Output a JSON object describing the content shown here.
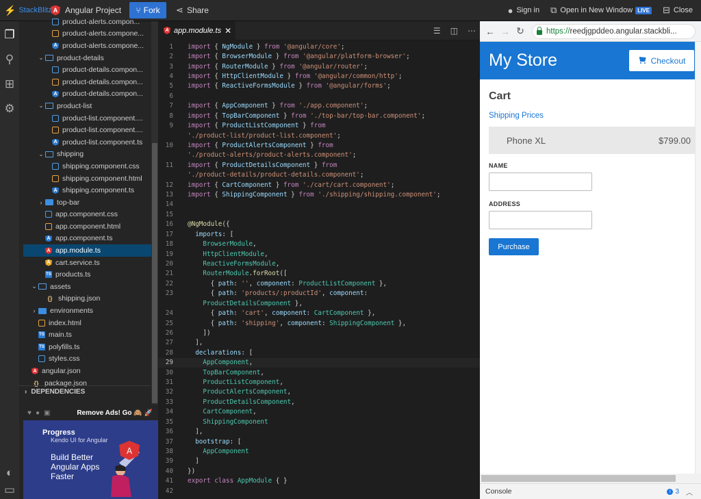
{
  "topbar": {
    "brand": "StackBlitz",
    "project": "Angular Project",
    "fork": "Fork",
    "share": "Share",
    "signin": "Sign in",
    "open_new": "Open in New Window",
    "live": "LIVE",
    "close": "Close"
  },
  "tree": [
    {
      "label": "product-alerts.compon...",
      "type": "css",
      "depth": 3
    },
    {
      "label": "product-alerts.compone...",
      "type": "html",
      "depth": 3
    },
    {
      "label": "product-alerts.compone...",
      "type": "ts",
      "depth": 3
    },
    {
      "label": "product-details",
      "type": "folder",
      "depth": 2,
      "open": true
    },
    {
      "label": "product-details.compon...",
      "type": "css",
      "depth": 3
    },
    {
      "label": "product-details.compon...",
      "type": "html",
      "depth": 3
    },
    {
      "label": "product-details.compon...",
      "type": "ts",
      "depth": 3
    },
    {
      "label": "product-list",
      "type": "folder",
      "depth": 2,
      "open": true
    },
    {
      "label": "product-list.component....",
      "type": "css",
      "depth": 3
    },
    {
      "label": "product-list.component....",
      "type": "html",
      "depth": 3
    },
    {
      "label": "product-list.component.ts",
      "type": "ts",
      "depth": 3
    },
    {
      "label": "shipping",
      "type": "folder",
      "depth": 2,
      "open": true
    },
    {
      "label": "shipping.component.css",
      "type": "css",
      "depth": 3
    },
    {
      "label": "shipping.component.html",
      "type": "html",
      "depth": 3
    },
    {
      "label": "shipping.component.ts",
      "type": "ts",
      "depth": 3
    },
    {
      "label": "top-bar",
      "type": "folder-closed",
      "depth": 2
    },
    {
      "label": "app.component.css",
      "type": "css",
      "depth": 2
    },
    {
      "label": "app.component.html",
      "type": "html",
      "depth": 2
    },
    {
      "label": "app.component.ts",
      "type": "ts",
      "depth": 2
    },
    {
      "label": "app.module.ts",
      "type": "ang",
      "depth": 2,
      "selected": true
    },
    {
      "label": "cart.service.ts",
      "type": "svc",
      "depth": 2
    },
    {
      "label": "products.ts",
      "type": "tsfile",
      "depth": 2
    },
    {
      "label": "assets",
      "type": "folder",
      "depth": 1,
      "open": true
    },
    {
      "label": "shipping.json",
      "type": "json",
      "depth": 2
    },
    {
      "label": "environments",
      "type": "folder-closed",
      "depth": 1
    },
    {
      "label": "index.html",
      "type": "html",
      "depth": 1
    },
    {
      "label": "main.ts",
      "type": "tsfile",
      "depth": 1
    },
    {
      "label": "polyfills.ts",
      "type": "tsfile",
      "depth": 1
    },
    {
      "label": "styles.css",
      "type": "css",
      "depth": 1
    },
    {
      "label": "angular.json",
      "type": "ang",
      "depth": 0
    },
    {
      "label": "package.json",
      "type": "json",
      "depth": 0
    }
  ],
  "dependencies": "DEPENDENCIES",
  "ads": {
    "remove": "Remove Ads! Go 🙈 🚀",
    "brand": "Progress",
    "sub": "Kendo UI for Angular",
    "headline": "Build Better Angular Apps Faster"
  },
  "editor": {
    "tab": "app.module.ts",
    "current_line": 29,
    "lines": [
      {
        "n": "1",
        "t": [
          [
            "k",
            "import"
          ],
          [
            "b",
            " { "
          ],
          [
            "p",
            "NgModule"
          ],
          [
            "b",
            " } "
          ],
          [
            "k",
            "from"
          ],
          [
            "s",
            " '@angular/core'"
          ],
          [
            "b",
            ";"
          ]
        ]
      },
      {
        "n": "2",
        "t": [
          [
            "k",
            "import"
          ],
          [
            "b",
            " { "
          ],
          [
            "p",
            "BrowserModule"
          ],
          [
            "b",
            " } "
          ],
          [
            "k",
            "from"
          ],
          [
            "s",
            " '@angular/platform-browser'"
          ],
          [
            "b",
            ";"
          ]
        ]
      },
      {
        "n": "3",
        "t": [
          [
            "k",
            "import"
          ],
          [
            "b",
            " { "
          ],
          [
            "p",
            "RouterModule"
          ],
          [
            "b",
            " } "
          ],
          [
            "k",
            "from"
          ],
          [
            "s",
            " '@angular/router'"
          ],
          [
            "b",
            ";"
          ]
        ]
      },
      {
        "n": "4",
        "t": [
          [
            "k",
            "import"
          ],
          [
            "b",
            " { "
          ],
          [
            "p",
            "HttpClientModule"
          ],
          [
            "b",
            " } "
          ],
          [
            "k",
            "from"
          ],
          [
            "s",
            " '@angular/common/http'"
          ],
          [
            "b",
            ";"
          ]
        ]
      },
      {
        "n": "5",
        "t": [
          [
            "k",
            "import"
          ],
          [
            "b",
            " { "
          ],
          [
            "p",
            "ReactiveFormsModule"
          ],
          [
            "b",
            " } "
          ],
          [
            "k",
            "from"
          ],
          [
            "s",
            " '@angular/forms'"
          ],
          [
            "b",
            ";"
          ]
        ]
      },
      {
        "n": "6",
        "t": []
      },
      {
        "n": "7",
        "t": [
          [
            "k",
            "import"
          ],
          [
            "b",
            " { "
          ],
          [
            "p",
            "AppComponent"
          ],
          [
            "b",
            " } "
          ],
          [
            "k",
            "from"
          ],
          [
            "s",
            " './app.component'"
          ],
          [
            "b",
            ";"
          ]
        ]
      },
      {
        "n": "8",
        "t": [
          [
            "k",
            "import"
          ],
          [
            "b",
            " { "
          ],
          [
            "p",
            "TopBarComponent"
          ],
          [
            "b",
            " } "
          ],
          [
            "k",
            "from"
          ],
          [
            "s",
            " './top-bar/top-bar.component'"
          ],
          [
            "b",
            ";"
          ]
        ]
      },
      {
        "n": "9",
        "t": [
          [
            "k",
            "import"
          ],
          [
            "b",
            " { "
          ],
          [
            "p",
            "ProductListComponent"
          ],
          [
            "b",
            " } "
          ],
          [
            "k",
            "from"
          ]
        ]
      },
      {
        "n": "",
        "t": [
          [
            "s",
            "'./product-list/product-list.component'"
          ],
          [
            "b",
            ";"
          ]
        ]
      },
      {
        "n": "10",
        "t": [
          [
            "k",
            "import"
          ],
          [
            "b",
            " { "
          ],
          [
            "p",
            "ProductAlertsComponent"
          ],
          [
            "b",
            " } "
          ],
          [
            "k",
            "from"
          ]
        ]
      },
      {
        "n": "",
        "t": [
          [
            "s",
            "'./product-alerts/product-alerts.component'"
          ],
          [
            "b",
            ";"
          ]
        ]
      },
      {
        "n": "11",
        "t": [
          [
            "k",
            "import"
          ],
          [
            "b",
            " { "
          ],
          [
            "p",
            "ProductDetailsComponent"
          ],
          [
            "b",
            " } "
          ],
          [
            "k",
            "from"
          ]
        ]
      },
      {
        "n": "",
        "t": [
          [
            "s",
            "'./product-details/product-details.component'"
          ],
          [
            "b",
            ";"
          ]
        ]
      },
      {
        "n": "12",
        "t": [
          [
            "k",
            "import"
          ],
          [
            "b",
            " { "
          ],
          [
            "p",
            "CartComponent"
          ],
          [
            "b",
            " } "
          ],
          [
            "k",
            "from"
          ],
          [
            "s",
            " './cart/cart.component'"
          ],
          [
            "b",
            ";"
          ]
        ]
      },
      {
        "n": "13",
        "t": [
          [
            "k",
            "import"
          ],
          [
            "b",
            " { "
          ],
          [
            "p",
            "ShippingComponent"
          ],
          [
            "b",
            " } "
          ],
          [
            "k",
            "from"
          ],
          [
            "s",
            " './shipping/shipping.component'"
          ],
          [
            "b",
            ";"
          ]
        ]
      },
      {
        "n": "14",
        "t": []
      },
      {
        "n": "15",
        "t": []
      },
      {
        "n": "16",
        "t": [
          [
            "f",
            "@NgModule"
          ],
          [
            "b",
            "({"
          ]
        ]
      },
      {
        "n": "17",
        "t": [
          [
            "b",
            "  "
          ],
          [
            "p",
            "imports"
          ],
          [
            "b",
            ": ["
          ]
        ]
      },
      {
        "n": "18",
        "t": [
          [
            "b",
            "    "
          ],
          [
            "c",
            "BrowserModule"
          ],
          [
            "b",
            ","
          ]
        ]
      },
      {
        "n": "19",
        "t": [
          [
            "b",
            "    "
          ],
          [
            "c",
            "HttpClientModule"
          ],
          [
            "b",
            ","
          ]
        ]
      },
      {
        "n": "20",
        "t": [
          [
            "b",
            "    "
          ],
          [
            "c",
            "ReactiveFormsModule"
          ],
          [
            "b",
            ","
          ]
        ]
      },
      {
        "n": "21",
        "t": [
          [
            "b",
            "    "
          ],
          [
            "c",
            "RouterModule"
          ],
          [
            "b",
            "."
          ],
          [
            "f",
            "forRoot"
          ],
          [
            "b",
            "(["
          ]
        ]
      },
      {
        "n": "22",
        "t": [
          [
            "b",
            "      { "
          ],
          [
            "p",
            "path"
          ],
          [
            "b",
            ": "
          ],
          [
            "s",
            "''"
          ],
          [
            "b",
            ", "
          ],
          [
            "p",
            "component"
          ],
          [
            "b",
            ": "
          ],
          [
            "c",
            "ProductListComponent"
          ],
          [
            "b",
            " },"
          ]
        ]
      },
      {
        "n": "23",
        "t": [
          [
            "b",
            "      { "
          ],
          [
            "p",
            "path"
          ],
          [
            "b",
            ": "
          ],
          [
            "s",
            "'products/:productId'"
          ],
          [
            "b",
            ", "
          ],
          [
            "p",
            "component"
          ],
          [
            "b",
            ":"
          ]
        ]
      },
      {
        "n": "",
        "t": [
          [
            "b",
            "    "
          ],
          [
            "c",
            "ProductDetailsComponent"
          ],
          [
            "b",
            " },"
          ]
        ]
      },
      {
        "n": "24",
        "t": [
          [
            "b",
            "      { "
          ],
          [
            "p",
            "path"
          ],
          [
            "b",
            ": "
          ],
          [
            "s",
            "'cart'"
          ],
          [
            "b",
            ", "
          ],
          [
            "p",
            "component"
          ],
          [
            "b",
            ": "
          ],
          [
            "c",
            "CartComponent"
          ],
          [
            "b",
            " },"
          ]
        ]
      },
      {
        "n": "25",
        "t": [
          [
            "b",
            "      { "
          ],
          [
            "p",
            "path"
          ],
          [
            "b",
            ": "
          ],
          [
            "s",
            "'shipping'"
          ],
          [
            "b",
            ", "
          ],
          [
            "p",
            "component"
          ],
          [
            "b",
            ": "
          ],
          [
            "c",
            "ShippingComponent"
          ],
          [
            "b",
            " },"
          ]
        ]
      },
      {
        "n": "26",
        "t": [
          [
            "b",
            "    ])"
          ]
        ]
      },
      {
        "n": "27",
        "t": [
          [
            "b",
            "  ],"
          ]
        ]
      },
      {
        "n": "28",
        "t": [
          [
            "b",
            "  "
          ],
          [
            "p",
            "declarations"
          ],
          [
            "b",
            ": ["
          ]
        ]
      },
      {
        "n": "29",
        "t": [
          [
            "b",
            "    "
          ],
          [
            "c",
            "AppComponent"
          ],
          [
            "b",
            ","
          ]
        ]
      },
      {
        "n": "30",
        "t": [
          [
            "b",
            "    "
          ],
          [
            "c",
            "TopBarComponent"
          ],
          [
            "b",
            ","
          ]
        ]
      },
      {
        "n": "31",
        "t": [
          [
            "b",
            "    "
          ],
          [
            "c",
            "ProductListComponent"
          ],
          [
            "b",
            ","
          ]
        ]
      },
      {
        "n": "32",
        "t": [
          [
            "b",
            "    "
          ],
          [
            "c",
            "ProductAlertsComponent"
          ],
          [
            "b",
            ","
          ]
        ]
      },
      {
        "n": "33",
        "t": [
          [
            "b",
            "    "
          ],
          [
            "c",
            "ProductDetailsComponent"
          ],
          [
            "b",
            ","
          ]
        ]
      },
      {
        "n": "34",
        "t": [
          [
            "b",
            "    "
          ],
          [
            "c",
            "CartComponent"
          ],
          [
            "b",
            ","
          ]
        ]
      },
      {
        "n": "35",
        "t": [
          [
            "b",
            "    "
          ],
          [
            "c",
            "ShippingComponent"
          ]
        ]
      },
      {
        "n": "36",
        "t": [
          [
            "b",
            "  ],"
          ]
        ]
      },
      {
        "n": "37",
        "t": [
          [
            "b",
            "  "
          ],
          [
            "p",
            "bootstrap"
          ],
          [
            "b",
            ": ["
          ]
        ]
      },
      {
        "n": "38",
        "t": [
          [
            "b",
            "    "
          ],
          [
            "c",
            "AppComponent"
          ]
        ]
      },
      {
        "n": "39",
        "t": [
          [
            "b",
            "  ]"
          ]
        ]
      },
      {
        "n": "40",
        "t": [
          [
            "b",
            "})"
          ]
        ]
      },
      {
        "n": "41",
        "t": [
          [
            "k",
            "export"
          ],
          [
            "b",
            " "
          ],
          [
            "k",
            "class"
          ],
          [
            "b",
            " "
          ],
          [
            "c",
            "AppModule"
          ],
          [
            "b",
            " { }"
          ]
        ]
      },
      {
        "n": "42",
        "t": []
      }
    ]
  },
  "preview": {
    "url_prefix": "https://",
    "url_host": "reedjgpddeo.angular.stackbli...",
    "store_title": "My Store",
    "checkout": "Checkout",
    "cart_title": "Cart",
    "shipping_link": "Shipping Prices",
    "item_name": "Phone XL",
    "item_price": "$799.00",
    "name_label": "NAME",
    "address_label": "ADDRESS",
    "purchase": "Purchase",
    "console": "Console",
    "console_count": "3",
    "accent": "#1976d2"
  }
}
